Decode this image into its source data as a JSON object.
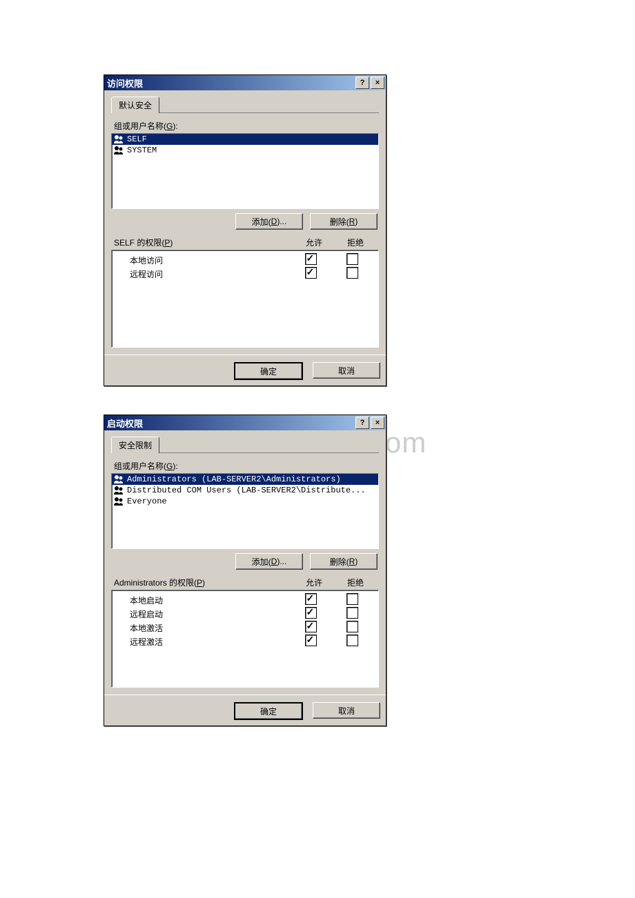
{
  "watermark": "www.bdocx.com",
  "titlebar_buttons": {
    "help": "?",
    "close": "×"
  },
  "dialog1": {
    "title": "访问权限",
    "tab": "默认安全",
    "group_label_pre": "组或用户名称(",
    "group_label_key": "G",
    "group_label_post": "):",
    "users": [
      {
        "name": "SELF",
        "selected": true
      },
      {
        "name": "SYSTEM",
        "selected": false
      }
    ],
    "add_button_pre": "添加(",
    "add_button_key": "D",
    "add_button_post": ")...",
    "remove_button_pre": "删除(",
    "remove_button_key": "R",
    "remove_button_post": ")",
    "perm_label_pre": "SELF 的权限(",
    "perm_label_key": "P",
    "perm_label_post": ")",
    "allow_header": "允许",
    "deny_header": "拒绝",
    "permissions": [
      {
        "name": "本地访问",
        "allow": true,
        "deny": false
      },
      {
        "name": "远程访问",
        "allow": true,
        "deny": false
      }
    ],
    "ok_button": "确定",
    "cancel_button": "取消"
  },
  "dialog2": {
    "title": "启动权限",
    "tab": "安全限制",
    "group_label_pre": "组或用户名称(",
    "group_label_key": "G",
    "group_label_post": "):",
    "users": [
      {
        "name": "Administrators (LAB-SERVER2\\Administrators)",
        "selected": true
      },
      {
        "name": "Distributed COM Users (LAB-SERVER2\\Distribute...",
        "selected": false
      },
      {
        "name": "Everyone",
        "selected": false
      }
    ],
    "add_button_pre": "添加(",
    "add_button_key": "D",
    "add_button_post": ")...",
    "remove_button_pre": "删除(",
    "remove_button_key": "R",
    "remove_button_post": ")",
    "perm_label_pre": "Administrators 的权限(",
    "perm_label_key": "P",
    "perm_label_post": ")",
    "allow_header": "允许",
    "deny_header": "拒绝",
    "permissions": [
      {
        "name": "本地启动",
        "allow": true,
        "deny": false
      },
      {
        "name": "远程启动",
        "allow": true,
        "deny": false
      },
      {
        "name": "本地激活",
        "allow": true,
        "deny": false
      },
      {
        "name": "远程激活",
        "allow": true,
        "deny": false
      }
    ],
    "ok_button": "确定",
    "cancel_button": "取消"
  }
}
